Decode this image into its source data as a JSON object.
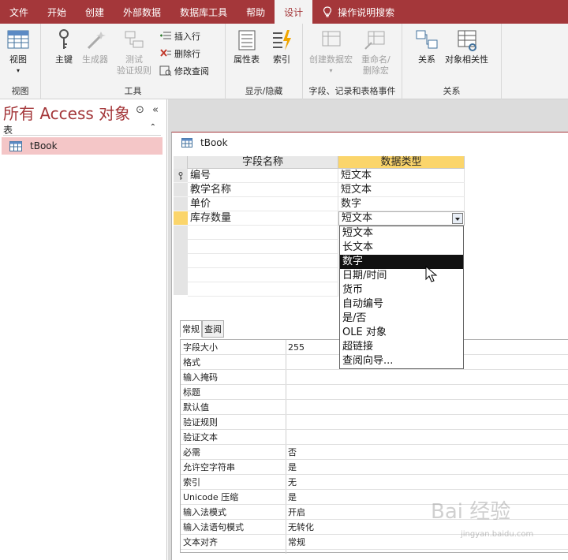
{
  "ribbon_tabs": [
    "文件",
    "开始",
    "创建",
    "外部数据",
    "数据库工具",
    "帮助",
    "设计"
  ],
  "tell_me": "操作说明搜索",
  "groups": {
    "view": {
      "label": "视图",
      "view_btn": "视图"
    },
    "tools": {
      "label": "工具",
      "primary_key": "主键",
      "builder": "生成器",
      "test_rules": "测试\n验证规则",
      "insert_rows": "插入行",
      "delete_rows": "删除行",
      "modify_lookups": "修改查阅"
    },
    "show_hide": {
      "label": "显示/隐藏",
      "property_sheet": "属性表",
      "indexes": "索引"
    },
    "events": {
      "label": "字段、记录和表格事件",
      "create_macro": "创建数据宏",
      "rename_macro": "重命名/\n删除宏"
    },
    "relations": {
      "label": "关系",
      "relationships": "关系",
      "dependencies": "对象相关性"
    }
  },
  "nav": {
    "title": "所有 Access 对象",
    "section": "表",
    "items": [
      "tBook"
    ]
  },
  "document": {
    "tab_title": "tBook",
    "headers": [
      "字段名称",
      "数据类型"
    ],
    "rows": [
      {
        "name": "编号",
        "type": "短文本",
        "primary_key": true
      },
      {
        "name": "教学名称",
        "type": "短文本"
      },
      {
        "name": "单价",
        "type": "数字"
      },
      {
        "name": "库存数量",
        "type": "短文本"
      }
    ],
    "combo_value": "短文本"
  },
  "dropdown": {
    "options": [
      "短文本",
      "长文本",
      "数字",
      "日期/时间",
      "货币",
      "自动编号",
      "是/否",
      "OLE 对象",
      "超链接",
      "查阅向导..."
    ],
    "highlighted_index": 2
  },
  "properties": {
    "tabs": [
      "常规",
      "查阅"
    ],
    "rows": [
      {
        "name": "字段大小",
        "value": "255"
      },
      {
        "name": "格式",
        "value": ""
      },
      {
        "name": "输入掩码",
        "value": ""
      },
      {
        "name": "标题",
        "value": ""
      },
      {
        "name": "默认值",
        "value": ""
      },
      {
        "name": "验证规则",
        "value": ""
      },
      {
        "name": "验证文本",
        "value": ""
      },
      {
        "name": "必需",
        "value": "否"
      },
      {
        "name": "允许空字符串",
        "value": "是"
      },
      {
        "name": "索引",
        "value": "无"
      },
      {
        "name": "Unicode 压缩",
        "value": "是"
      },
      {
        "name": "输入法模式",
        "value": "开启"
      },
      {
        "name": "输入法语句模式",
        "value": "无转化"
      },
      {
        "name": "文本对齐",
        "value": "常规"
      }
    ]
  },
  "watermark": {
    "brand": "Bai 经验",
    "url": "jingyan.baidu.com"
  },
  "colors": {
    "accent": "#a4373a",
    "selection": "#fbd56b",
    "nav_selected": "#f4c6c7"
  }
}
